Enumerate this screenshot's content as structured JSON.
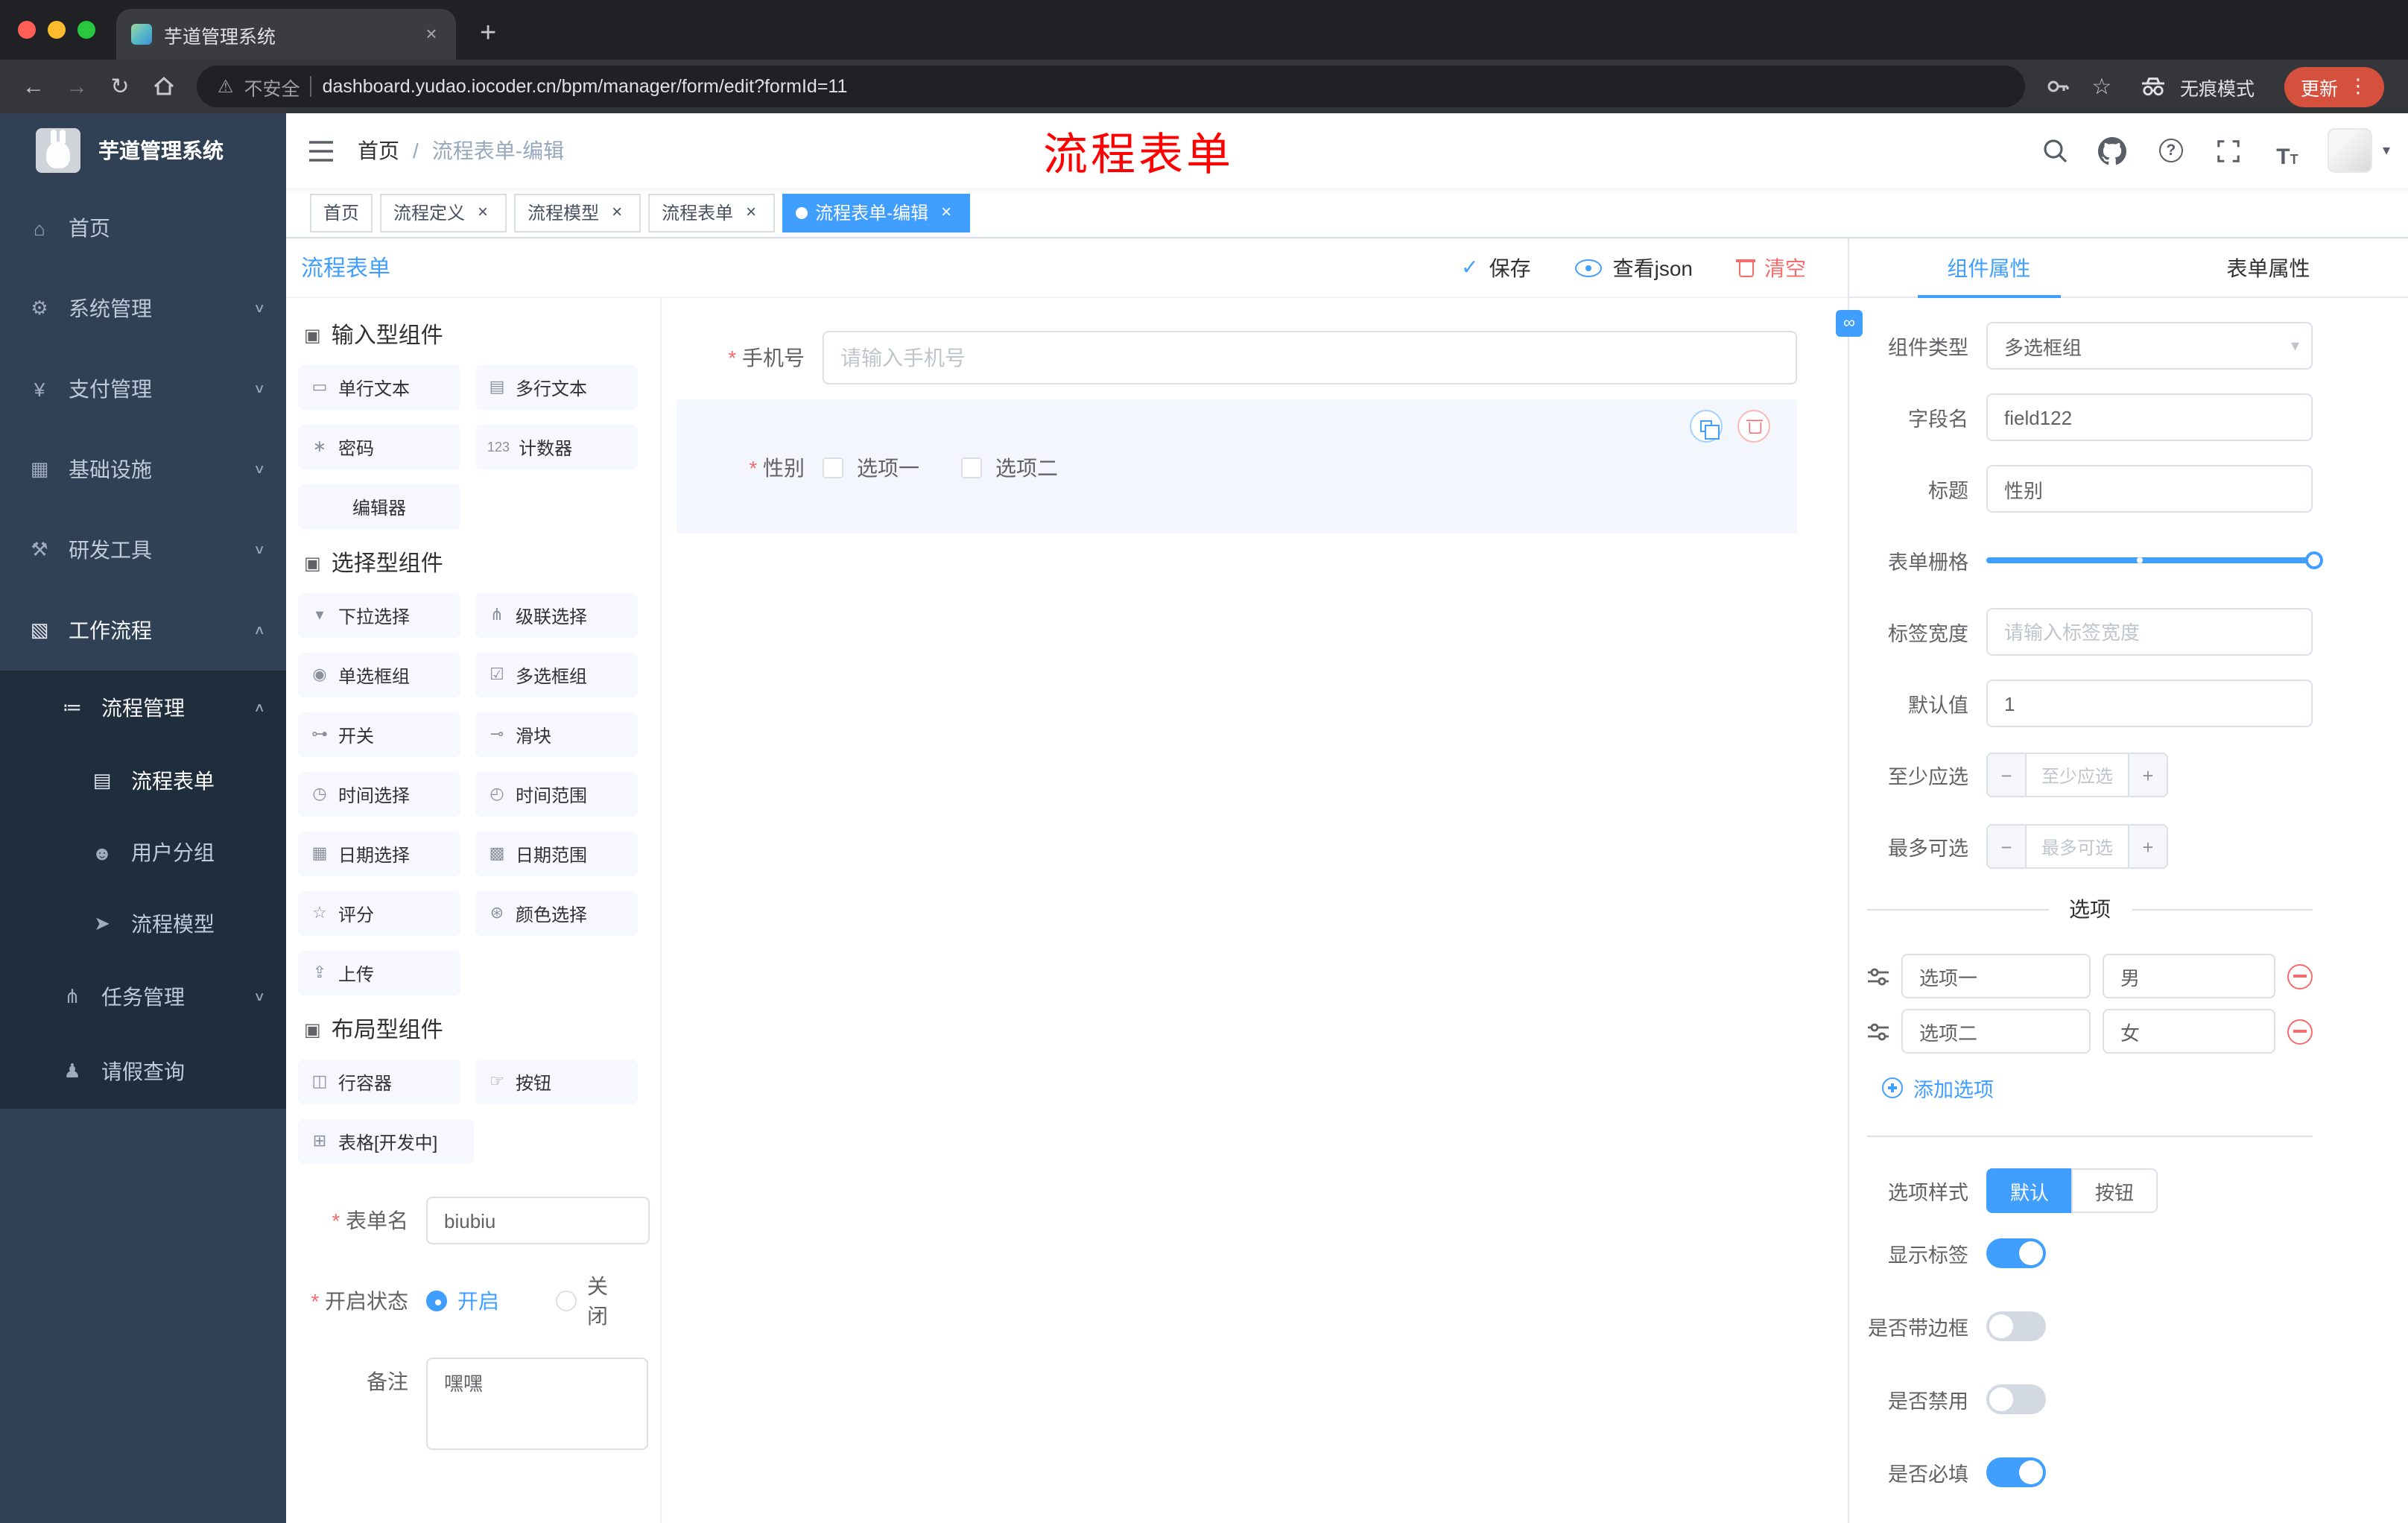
{
  "browser": {
    "tab": {
      "title": "芋道管理系统"
    },
    "address": {
      "security": "不安全",
      "url": "dashboard.yudao.iocoder.cn/bpm/manager/form/edit?formId=11"
    },
    "incognito": "无痕模式",
    "update": "更新"
  },
  "sidebar": {
    "title": "芋道管理系统",
    "items": [
      {
        "id": "home",
        "label": "首页",
        "icon": "⌂",
        "icon_name": "home-icon",
        "level": 1
      },
      {
        "id": "system-management",
        "label": "系统管理",
        "icon": "⚙",
        "icon_name": "gear-icon",
        "level": 1,
        "chevron": "down"
      },
      {
        "id": "payment-management",
        "label": "支付管理",
        "icon": "¥",
        "icon_name": "yen-icon",
        "level": 1,
        "chevron": "down"
      },
      {
        "id": "infrastructure",
        "label": "基础设施",
        "icon": "▦",
        "icon_name": "monitor-icon",
        "level": 1,
        "chevron": "down"
      },
      {
        "id": "dev-tools",
        "label": "研发工具",
        "icon": "⚒",
        "icon_name": "tools-icon",
        "level": 1,
        "chevron": "down"
      },
      {
        "id": "workflow",
        "label": "工作流程",
        "icon": "▧",
        "icon_name": "briefcase-icon",
        "level": 1,
        "chevron": "up",
        "open": true
      },
      {
        "id": "process-management",
        "label": "流程管理",
        "icon": "≔",
        "icon_name": "list-icon",
        "level": 2,
        "chevron": "up",
        "open": true,
        "dark": true
      },
      {
        "id": "process-form",
        "label": "流程表单",
        "icon": "▤",
        "icon_name": "document-icon",
        "level": 3,
        "active": true,
        "dark": true
      },
      {
        "id": "user-group",
        "label": "用户分组",
        "icon": "☻",
        "icon_name": "users-icon",
        "level": 3,
        "dark": true
      },
      {
        "id": "process-model",
        "label": "流程模型",
        "icon": "➤",
        "icon_name": "send-icon",
        "level": 3,
        "dark": true
      },
      {
        "id": "task-management",
        "label": "任务管理",
        "icon": "⋔",
        "icon_name": "tree-icon",
        "level": 2,
        "chevron": "down",
        "dark": true
      },
      {
        "id": "leave-query",
        "label": "请假查询",
        "icon": "♟",
        "icon_name": "person-icon",
        "level": 2,
        "dark": true
      }
    ]
  },
  "navbar": {
    "breadcrumb": {
      "home": "首页",
      "separator": "/",
      "current": "流程表单-编辑"
    },
    "annotation": "流程表单"
  },
  "tags": [
    {
      "label": "首页",
      "closable": false,
      "active": false
    },
    {
      "label": "流程定义",
      "closable": true,
      "active": false
    },
    {
      "label": "流程模型",
      "closable": true,
      "active": false
    },
    {
      "label": "流程表单",
      "closable": true,
      "active": false
    },
    {
      "label": "流程表单-编辑",
      "closable": true,
      "active": true
    }
  ],
  "editor": {
    "title": "流程表单",
    "save": "保存",
    "view_json": "查看json",
    "clear": "清空"
  },
  "palette": {
    "sections": [
      {
        "title": "输入型组件",
        "items": [
          {
            "label": "单行文本",
            "icon": "▭",
            "icon_name": "single-line-text-icon"
          },
          {
            "label": "多行文本",
            "icon": "▤",
            "icon_name": "textarea-icon"
          },
          {
            "label": "密码",
            "icon": "∗",
            "icon_name": "password-icon"
          },
          {
            "label": "计数器",
            "icon": "123",
            "icon_name": "counter-icon"
          },
          {
            "label": "编辑器",
            "icon": "",
            "icon_name": "editor-icon",
            "center": true
          }
        ]
      },
      {
        "title": "选择型组件",
        "items": [
          {
            "label": "下拉选择",
            "icon": "▾",
            "icon_name": "select-icon"
          },
          {
            "label": "级联选择",
            "icon": "⋔",
            "icon_name": "cascader-icon"
          },
          {
            "label": "单选框组",
            "icon": "◉",
            "icon_name": "radio-group-icon"
          },
          {
            "label": "多选框组",
            "icon": "☑",
            "icon_name": "checkbox-group-icon"
          },
          {
            "label": "开关",
            "icon": "⊶",
            "icon_name": "switch-icon"
          },
          {
            "label": "滑块",
            "icon": "⊸",
            "icon_name": "slider-icon"
          },
          {
            "label": "时间选择",
            "icon": "◷",
            "icon_name": "time-picker-icon"
          },
          {
            "label": "时间范围",
            "icon": "◴",
            "icon_name": "time-range-icon"
          },
          {
            "label": "日期选择",
            "icon": "▦",
            "icon_name": "date-picker-icon"
          },
          {
            "label": "日期范围",
            "icon": "▩",
            "icon_name": "date-range-icon"
          },
          {
            "label": "评分",
            "icon": "☆",
            "icon_name": "rate-icon"
          },
          {
            "label": "颜色选择",
            "icon": "⊛",
            "icon_name": "color-picker-icon"
          },
          {
            "label": "上传",
            "icon": "⇪",
            "icon_name": "upload-icon"
          }
        ]
      },
      {
        "title": "布局型组件",
        "items": [
          {
            "label": "行容器",
            "icon": "◫",
            "icon_name": "row-container-icon"
          },
          {
            "label": "按钮",
            "icon": "☞",
            "icon_name": "button-icon"
          },
          {
            "label": "表格[开发中]",
            "icon": "⊞",
            "icon_name": "table-icon",
            "wide": true
          }
        ]
      }
    ],
    "form": {
      "name_label": "表单名",
      "name_value": "biubiu",
      "status_label": "开启状态",
      "status_on": "开启",
      "status_off": "关闭",
      "remark_label": "备注",
      "remark_value": "嘿嘿"
    }
  },
  "canvas": {
    "phone": {
      "label": "手机号",
      "placeholder": "请输入手机号"
    },
    "gender": {
      "label": "性别",
      "options": [
        "选项一",
        "选项二"
      ]
    }
  },
  "properties": {
    "tabs": {
      "component": "组件属性",
      "form": "表单属性"
    },
    "component_type": {
      "label": "组件类型",
      "value": "多选框组"
    },
    "field_name": {
      "label": "字段名",
      "value": "field122"
    },
    "title": {
      "label": "标题",
      "value": "性别"
    },
    "grid": {
      "label": "表单栅格"
    },
    "label_width": {
      "label": "标签宽度",
      "placeholder": "请输入标签宽度"
    },
    "default_value": {
      "label": "默认值",
      "value": "1"
    },
    "min_select": {
      "label": "至少应选",
      "placeholder": "至少应选"
    },
    "max_select": {
      "label": "最多可选",
      "placeholder": "最多可选"
    },
    "options_title": "选项",
    "options": [
      {
        "label": "选项一",
        "value": "男"
      },
      {
        "label": "选项二",
        "value": "女"
      }
    ],
    "add_option": "添加选项",
    "option_style": {
      "label": "选项样式",
      "default": "默认",
      "button": "按钮"
    },
    "toggles": [
      {
        "label": "显示标签",
        "on": true
      },
      {
        "label": "是否带边框",
        "on": false
      },
      {
        "label": "是否禁用",
        "on": false
      },
      {
        "label": "是否必填",
        "on": true
      }
    ]
  },
  "glyphs": {
    "close": "×",
    "plus": "+",
    "minus": "−",
    "kebab": "⋮",
    "caret_down": "▾",
    "chev_up": "∧",
    "chev_down": "∨",
    "back": "←",
    "forward": "→",
    "reload": "↻",
    "star": "☆",
    "warning": "⚠",
    "check": "✓",
    "question": "?",
    "t": "T",
    "link": "∞",
    "cube": "▣"
  },
  "colors": {
    "primary": "#409eff",
    "danger": "#f56c6c",
    "sidebar_bg": "#304156",
    "submenu_bg": "#1f2d3d",
    "annotation": "#ff0000",
    "update_pill": "#d6503e",
    "browser_dark": "#202124",
    "tag_active": "#409eff"
  }
}
